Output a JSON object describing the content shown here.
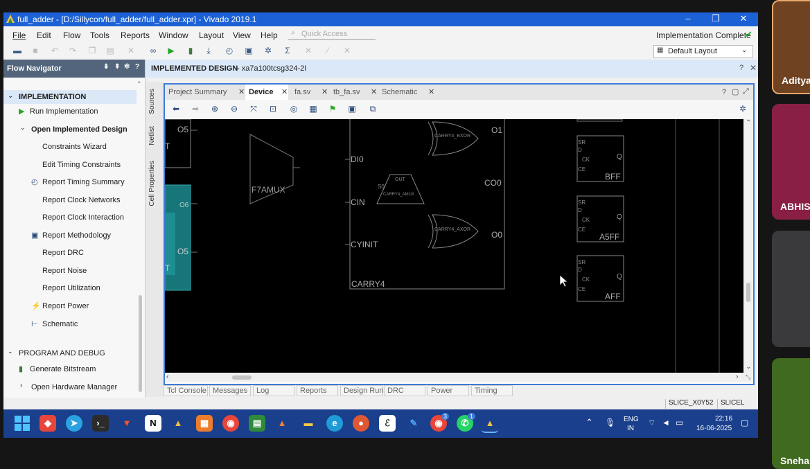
{
  "window": {
    "title": "full_adder - [D:/Sillycon/full_adder/full_adder.xpr] - Vivado 2019.1",
    "min_icon": "minimize-icon",
    "max_icon": "restore-icon",
    "close_icon": "close-icon",
    "min_glyph": "–",
    "max_glyph": "❐",
    "close_glyph": "✕"
  },
  "menu": {
    "items": [
      "File",
      "Edit",
      "Flow",
      "Tools",
      "Reports",
      "Window",
      "Layout",
      "View",
      "Help"
    ],
    "quick_access_placeholder": "Quick Access",
    "status": "Implementation Complete",
    "status_color": "#2aa52a",
    "layout_select": "Default Layout"
  },
  "flow_navigator": {
    "title": "Flow Navigator",
    "sections": {
      "implementation": "IMPLEMENTATION",
      "program_debug": "PROGRAM AND DEBUG"
    },
    "items": {
      "run_impl": "Run Implementation",
      "open_impl": "Open Implemented Design",
      "constraints_wizard": "Constraints Wizard",
      "edit_timing": "Edit Timing Constraints",
      "report_timing": "Report Timing Summary",
      "report_clock_networks": "Report Clock Networks",
      "report_clock_interaction": "Report Clock Interaction",
      "report_methodology": "Report Methodology",
      "report_drc": "Report DRC",
      "report_noise": "Report Noise",
      "report_utilization": "Report Utilization",
      "report_power": "Report Power",
      "schematic": "Schematic",
      "generate_bitstream": "Generate Bitstream",
      "open_hw_manager": "Open Hardware Manager"
    }
  },
  "design": {
    "header_title": "IMPLEMENTED DESIGN",
    "header_part": "- xa7a100tcsg324-2I",
    "side_tabs": [
      "Sources",
      "Netlist",
      "Cell Properties"
    ],
    "tabs": [
      "Project Summary",
      "Device",
      "fa.sv",
      "tb_fa.sv",
      "Schematic"
    ],
    "active_tab": "Device"
  },
  "canvas": {
    "left_labels": [
      "O5",
      "O6",
      "O5",
      "T",
      "T"
    ],
    "f7amux": "F7AMUX",
    "carry_pins": [
      "DI0",
      "CIN",
      "CYINIT"
    ],
    "carry_block": "CARRY4",
    "carry_outs": [
      "O1",
      "CO0",
      "O0"
    ],
    "small_labels": {
      "bxor": "CARRY4_BXOR",
      "amux": "CARRY4_AMUX",
      "axor": "CARRY4_AXOR",
      "out": "OUT",
      "s0": "S0"
    },
    "flops": [
      {
        "name": "BFF",
        "pins": [
          "SR",
          "D",
          "CK",
          "CE"
        ],
        "q": "Q"
      },
      {
        "name": "A5FF",
        "pins": [
          "SR",
          "D",
          "CK",
          "CE"
        ],
        "q": "Q"
      },
      {
        "name": "AFF",
        "pins": [
          "SR",
          "D",
          "CK",
          "CE"
        ],
        "q": "Q"
      }
    ]
  },
  "bottom_tabs": [
    "Tcl Console",
    "Messages",
    "Log",
    "Reports",
    "Design Runs",
    "DRC",
    "Power",
    "Timing"
  ],
  "status_bar": {
    "site": "SLICE_X0Y52",
    "type": "SLICEL"
  },
  "taskbar": {
    "lang_top": "ENG",
    "lang_bottom": "IN",
    "time": "22:16",
    "date": "16-06-2025",
    "badges": [
      "3",
      "1"
    ]
  },
  "participants": [
    "Aditya",
    "ABHIS",
    "Sneha"
  ]
}
